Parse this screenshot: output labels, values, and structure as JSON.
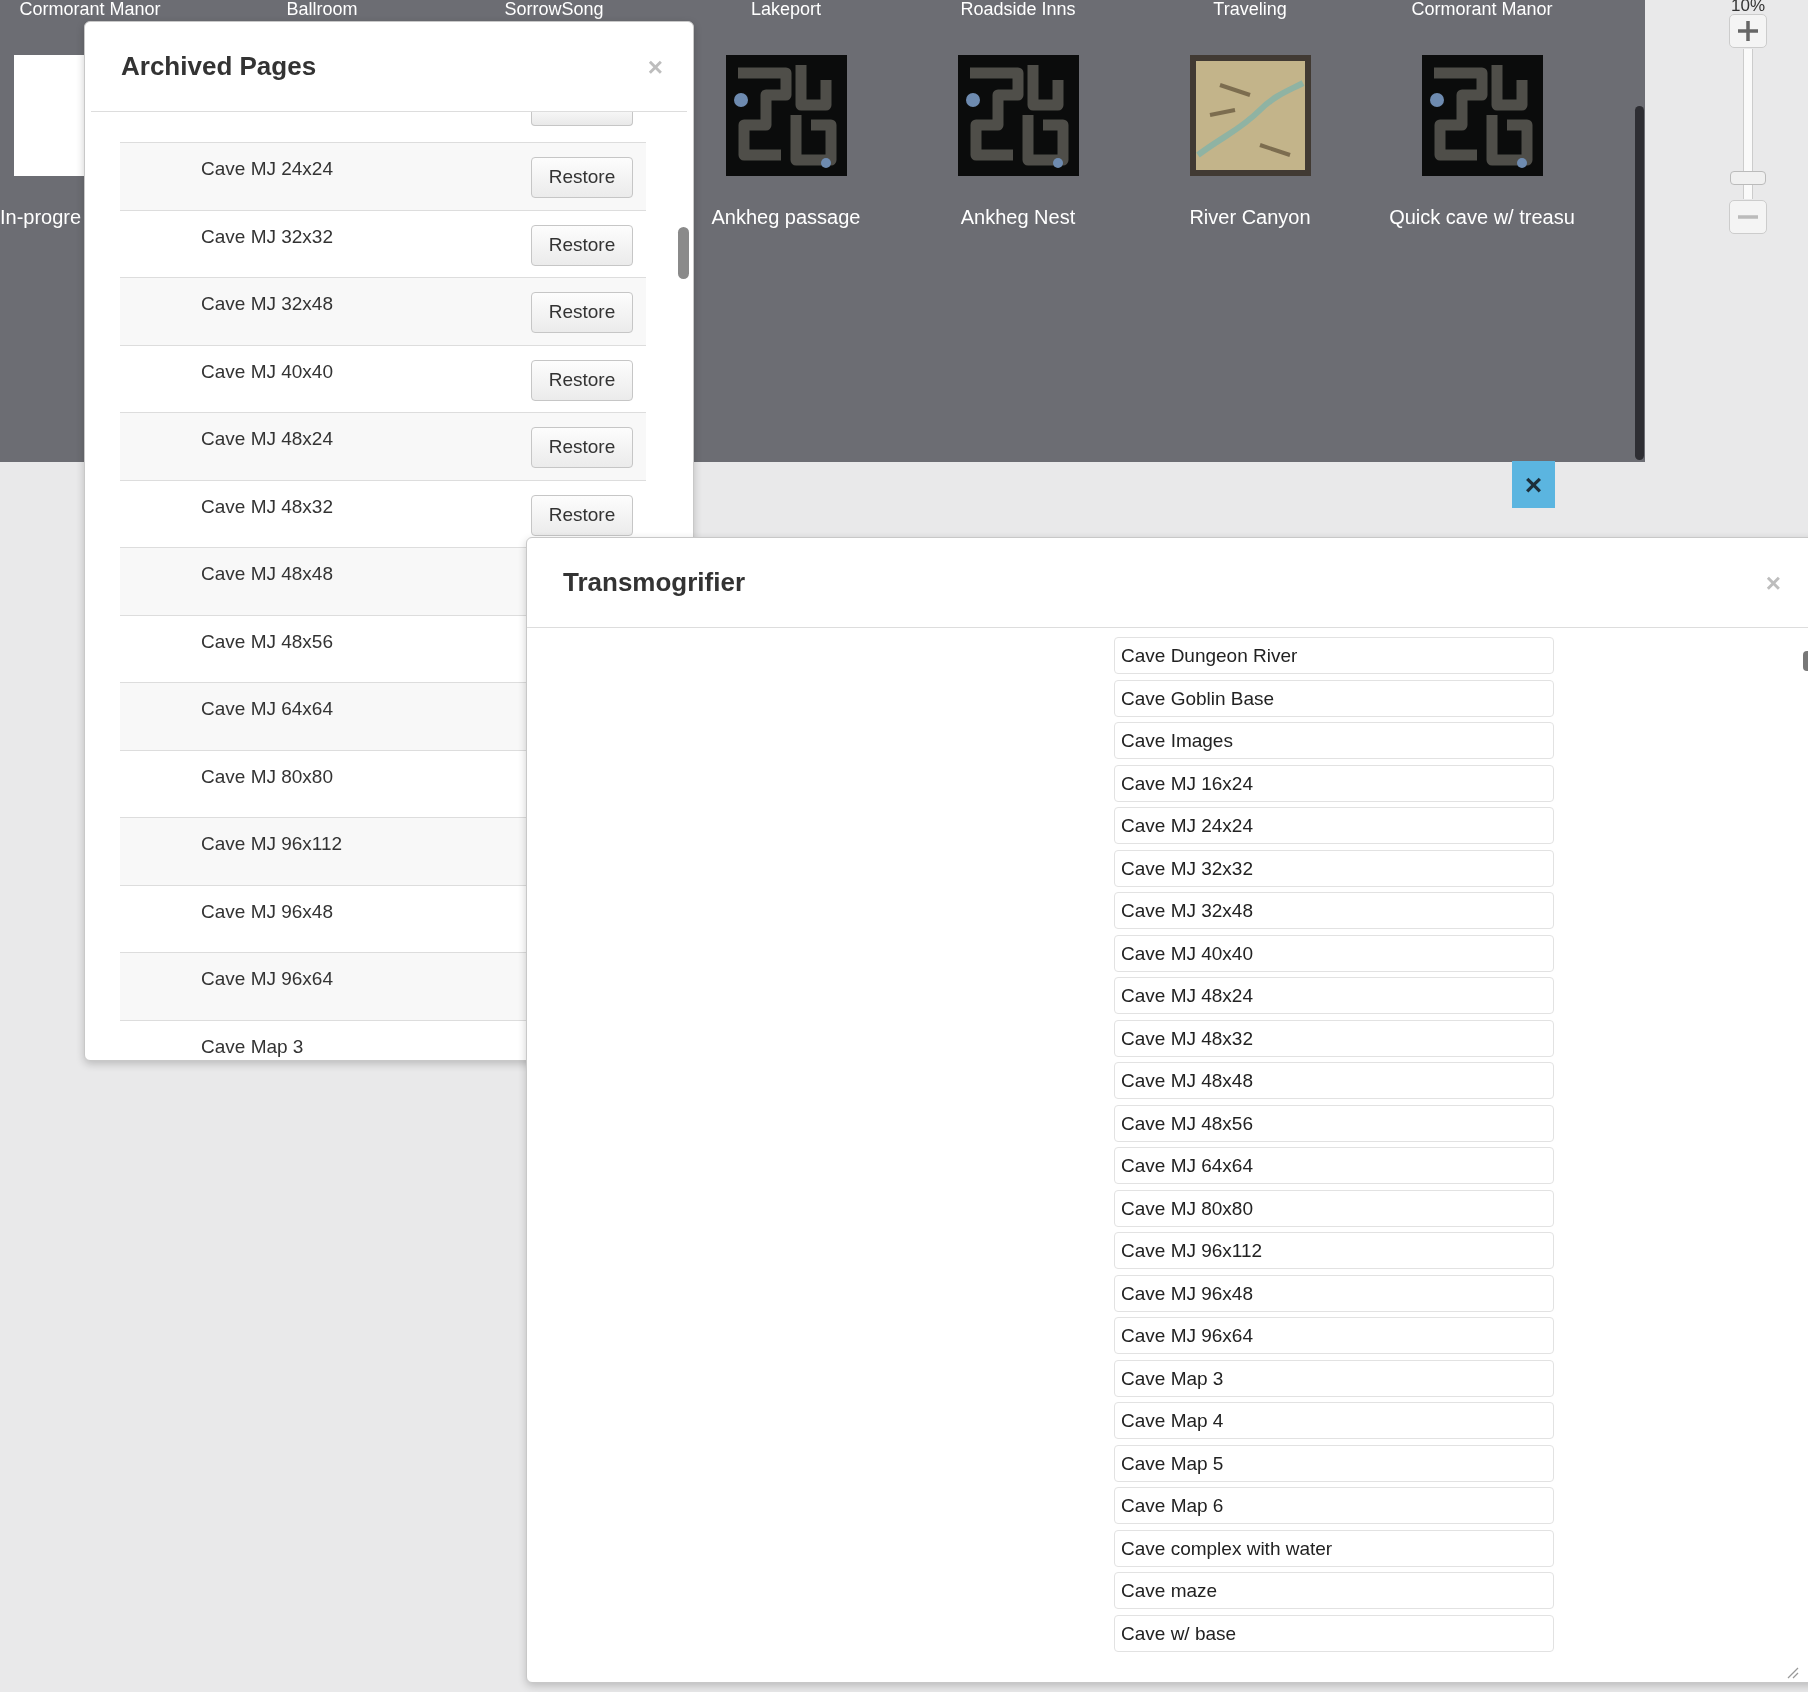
{
  "page_labels_top": [
    {
      "label": "Cormorant Manor"
    },
    {
      "label": "Ballroom"
    },
    {
      "label": "SorrowSong"
    },
    {
      "label": "Lakeport"
    },
    {
      "label": "Roadside Inns"
    },
    {
      "label": "Traveling"
    },
    {
      "label": "Cormorant Manor"
    }
  ],
  "page_tiles": [
    {
      "kind": "cut",
      "thumbnail": {
        "kind": "blank"
      },
      "label": "In-progre"
    },
    {
      "kind": "full",
      "thumbnail": {
        "kind": "cave"
      },
      "label": "Ankheg passage"
    },
    {
      "kind": "full",
      "thumbnail": {
        "kind": "cave"
      },
      "label": "Ankheg Nest"
    },
    {
      "kind": "full",
      "thumbnail": {
        "kind": "canyon"
      },
      "label": "River Canyon"
    },
    {
      "kind": "full",
      "thumbnail": {
        "kind": "cave"
      },
      "label": "Quick cave w/ treasu"
    }
  ],
  "zoom": {
    "reading": "10%",
    "level": 0.1
  },
  "overlay_close": "×",
  "archived_pages": {
    "title": "Archived Pages",
    "close": "×",
    "rows": [
      {
        "name": "Cave MJ 24x24",
        "button": "Restore"
      },
      {
        "name": "Cave MJ 32x32",
        "button": "Restore"
      },
      {
        "name": "Cave MJ 32x48",
        "button": "Restore"
      },
      {
        "name": "Cave MJ 40x40",
        "button": "Restore"
      },
      {
        "name": "Cave MJ 48x24",
        "button": "Restore"
      },
      {
        "name": "Cave MJ 48x32",
        "button": "Restore"
      },
      {
        "name": "Cave MJ 48x48"
      },
      {
        "name": "Cave MJ 48x56"
      },
      {
        "name": "Cave MJ 64x64"
      },
      {
        "name": "Cave MJ 80x80"
      },
      {
        "name": "Cave MJ 96x112"
      },
      {
        "name": "Cave MJ 96x48"
      },
      {
        "name": "Cave MJ 96x64"
      },
      {
        "name": "Cave Map 3"
      }
    ]
  },
  "transmogrifier": {
    "title": "Transmogrifier",
    "close": "×",
    "items": [
      "Cave Dungeon River",
      "Cave Goblin Base",
      "Cave Images",
      "Cave MJ 16x24",
      "Cave MJ 24x24",
      "Cave MJ 32x32",
      "Cave MJ 32x48",
      "Cave MJ 40x40",
      "Cave MJ 48x24",
      "Cave MJ 48x32",
      "Cave MJ 48x48",
      "Cave MJ 48x56",
      "Cave MJ 64x64",
      "Cave MJ 80x80",
      "Cave MJ 96x112",
      "Cave MJ 96x48",
      "Cave MJ 96x64",
      "Cave Map 3",
      "Cave Map 4",
      "Cave Map 5",
      "Cave Map 6",
      "Cave complex with water",
      "Cave maze",
      "Cave w/ base"
    ]
  }
}
